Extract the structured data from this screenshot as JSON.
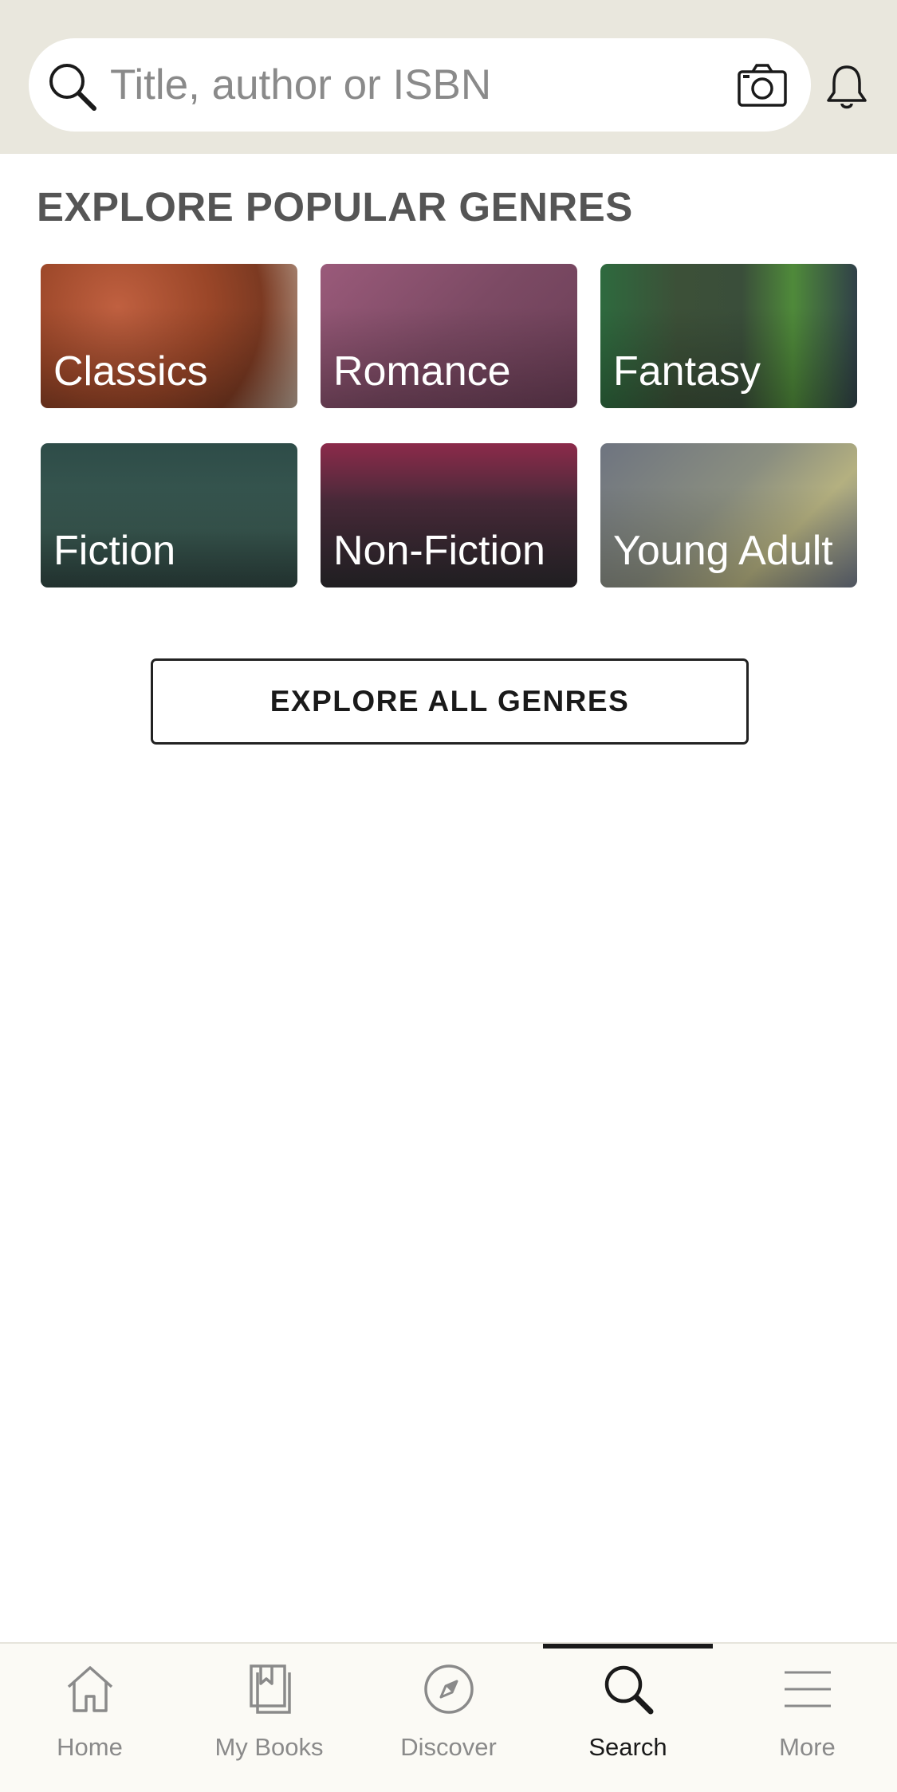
{
  "search": {
    "placeholder": "Title, author or ISBN",
    "icons": {
      "search": "search-icon",
      "camera": "camera-icon",
      "notifications": "bell-icon"
    }
  },
  "section": {
    "title": "EXPLORE POPULAR GENRES"
  },
  "genres": [
    {
      "label": "Classics"
    },
    {
      "label": "Romance"
    },
    {
      "label": "Fantasy"
    },
    {
      "label": "Fiction"
    },
    {
      "label": "Non-Fiction"
    },
    {
      "label": "Young Adult"
    }
  ],
  "explore_all": {
    "label": "EXPLORE ALL GENRES"
  },
  "tab_bar": {
    "active": "Search",
    "tabs": [
      {
        "label": "Home",
        "icon": "home-icon"
      },
      {
        "label": "My Books",
        "icon": "books-icon"
      },
      {
        "label": "Discover",
        "icon": "compass-icon"
      },
      {
        "label": "Search",
        "icon": "search-icon"
      },
      {
        "label": "More",
        "icon": "menu-icon"
      }
    ]
  },
  "colors": {
    "header_bg": "#e9e7dd",
    "text_dark": "#1a1a1a",
    "text_muted": "#8a8a8a",
    "section_title": "#555555"
  }
}
